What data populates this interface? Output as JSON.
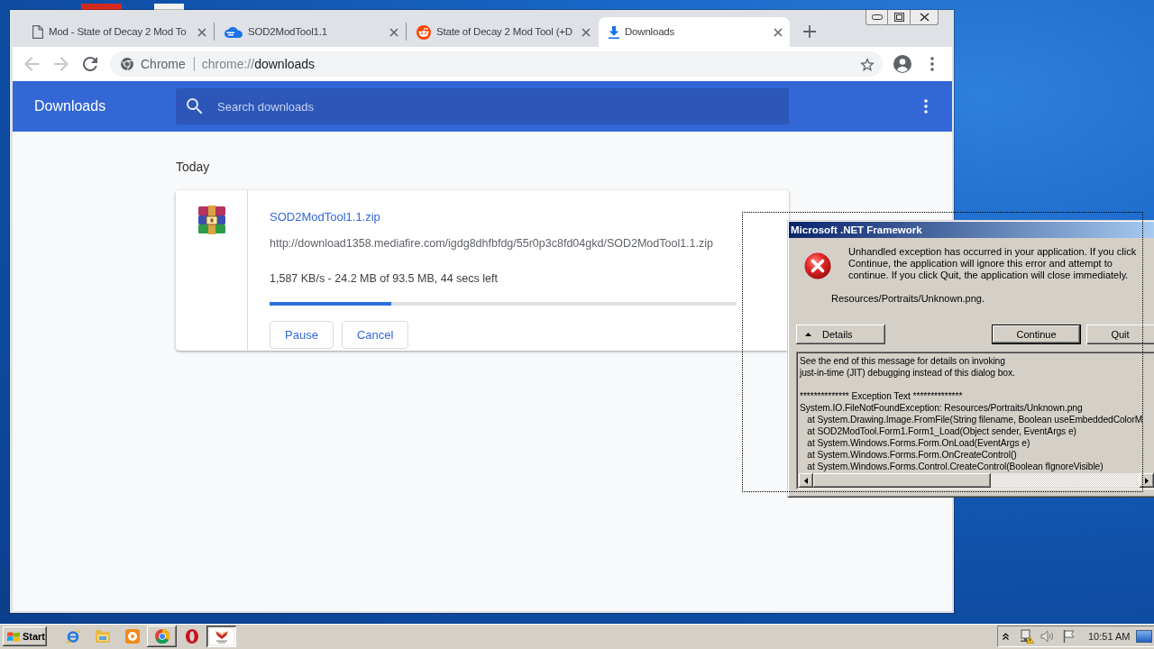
{
  "browser": {
    "tabs": [
      {
        "kind": "page",
        "title": "Mod - State of Decay 2 Mod To",
        "selected": false
      },
      {
        "kind": "cloud",
        "title": "SOD2ModTool1.1",
        "selected": false
      },
      {
        "kind": "forum",
        "title": "State of Decay 2 Mod Tool (+D",
        "selected": false
      },
      {
        "kind": "downloads",
        "title": "Downloads",
        "selected": true
      }
    ],
    "nav_buttons": [
      {
        "kind": "back",
        "disabled": true
      },
      {
        "kind": "forward",
        "disabled": true
      },
      {
        "kind": "reload",
        "disabled": false
      }
    ],
    "omnibox": {
      "site_label": "Chrome",
      "url_scheme": "chrome://",
      "url_path": "downloads"
    },
    "page": {
      "title": "Downloads",
      "search": {
        "placeholder": "Search downloads"
      },
      "date_heading": "Today",
      "downloads": [
        {
          "file_name": "SOD2ModTool1.1.zip",
          "url": "http://download1358.mediafire.com/igdg8dhfbfdg/55r0p3c8fd04gkd/SOD2ModTool1.1.zip",
          "status": "1,587 KB/s - 24.2 MB of 93.5 MB, 44 secs left",
          "level": 0.26,
          "actions": [
            "Pause",
            "Cancel"
          ]
        }
      ]
    }
  },
  "dialog": {
    "title": "Microsoft .NET Framework",
    "message": "Unhandled exception has occurred in your application. If you click Continue, the application will ignore this error and attempt to continue. If you click Quit, the application will close immediately.",
    "detail_line": "Resources/Portraits/Unknown.png.",
    "buttons": [
      {
        "kind": "toggle",
        "label": "Details"
      },
      {
        "kind": "default",
        "label": "Continue"
      },
      {
        "kind": "normal",
        "label": "Quit"
      }
    ],
    "details_text": "See the end of this message for details on invoking\njust-in-time (JIT) debugging instead of this dialog box.\n\n************** Exception Text **************\nSystem.IO.FileNotFoundException: Resources/Portraits/Unknown.png\n   at System.Drawing.Image.FromFile(String filename, Boolean useEmbeddedColorM\n   at SOD2ModTool.Form1.Form1_Load(Object sender, EventArgs e)\n   at System.Windows.Forms.Form.OnLoad(EventArgs e)\n   at System.Windows.Forms.Form.OnCreateControl()\n   at System.Windows.Forms.Control.CreateControl(Boolean fIgnoreVisible)"
  },
  "taskbar": {
    "start_label": "Start",
    "items": [
      {
        "kind": "web",
        "running": false,
        "selected": false
      },
      {
        "kind": "files",
        "running": false,
        "selected": false
      },
      {
        "kind": "media",
        "running": false,
        "selected": false
      },
      {
        "kind": "browser",
        "running": true,
        "selected": false
      },
      {
        "kind": "browser_alt",
        "running": false,
        "selected": false
      },
      {
        "kind": "app",
        "running": true,
        "selected": true
      }
    ],
    "clock": "10:51 AM"
  }
}
